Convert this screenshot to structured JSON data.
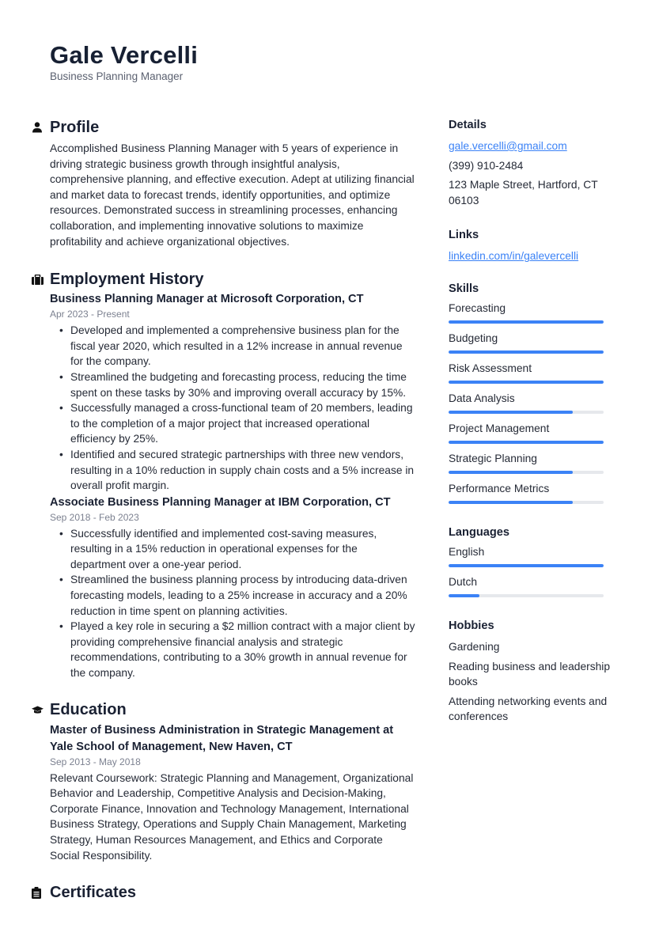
{
  "header": {
    "name": "Gale Vercelli",
    "title": "Business Planning Manager"
  },
  "colors": {
    "accent": "#3b82f6",
    "bar_track": "#e6e8ec",
    "heading": "#1a2133",
    "muted": "#7c8190"
  },
  "profile": {
    "heading": "Profile",
    "icon": "person-icon",
    "text": "Accomplished Business Planning Manager with 5 years of experience in driving strategic business growth through insightful analysis, comprehensive planning, and effective execution. Adept at utilizing financial and market data to forecast trends, identify opportunities, and optimize resources. Demonstrated success in streamlining processes, enhancing collaboration, and implementing innovative solutions to maximize profitability and achieve organizational objectives."
  },
  "employment": {
    "heading": "Employment History",
    "icon": "briefcase-icon",
    "jobs": [
      {
        "title": "Business Planning Manager at Microsoft Corporation, CT",
        "dates": "Apr 2023 - Present",
        "bullets": [
          "Developed and implemented a comprehensive business plan for the fiscal year 2020, which resulted in a 12% increase in annual revenue for the company.",
          "Streamlined the budgeting and forecasting process, reducing the time spent on these tasks by 30% and improving overall accuracy by 15%.",
          "Successfully managed a cross-functional team of 20 members, leading to the completion of a major project that increased operational efficiency by 25%.",
          "Identified and secured strategic partnerships with three new vendors, resulting in a 10% reduction in supply chain costs and a 5% increase in overall profit margin."
        ]
      },
      {
        "title": "Associate Business Planning Manager at IBM Corporation, CT",
        "dates": "Sep 2018 - Feb 2023",
        "bullets": [
          "Successfully identified and implemented cost-saving measures, resulting in a 15% reduction in operational expenses for the department over a one-year period.",
          "Streamlined the business planning process by introducing data-driven forecasting models, leading to a 25% increase in accuracy and a 20% reduction in time spent on planning activities.",
          "Played a key role in securing a $2 million contract with a major client by providing comprehensive financial analysis and strategic recommendations, contributing to a 30% growth in annual revenue for the company."
        ]
      }
    ]
  },
  "education": {
    "heading": "Education",
    "icon": "graduation-cap-icon",
    "entries": [
      {
        "title": "Master of Business Administration in Strategic Management at Yale School of Management, New Haven, CT",
        "dates": "Sep 2013 - May 2018",
        "text": "Relevant Coursework: Strategic Planning and Management, Organizational Behavior and Leadership, Competitive Analysis and Decision-Making, Corporate Finance, Innovation and Technology Management, International Business Strategy, Operations and Supply Chain Management, Marketing Strategy, Human Resources Management, and Ethics and Corporate Social Responsibility."
      }
    ]
  },
  "certificates": {
    "heading": "Certificates",
    "icon": "clipboard-icon"
  },
  "details": {
    "heading": "Details",
    "email": "gale.vercelli@gmail.com",
    "phone": "(399) 910-2484",
    "address": "123 Maple Street, Hartford, CT 06103"
  },
  "links": {
    "heading": "Links",
    "items": [
      "linkedin.com/in/galevercelli"
    ]
  },
  "skills": {
    "heading": "Skills",
    "items": [
      {
        "label": "Forecasting",
        "level_pct": 100
      },
      {
        "label": "Budgeting",
        "level_pct": 100
      },
      {
        "label": "Risk Assessment",
        "level_pct": 100
      },
      {
        "label": "Data Analysis",
        "level_pct": 80
      },
      {
        "label": "Project Management",
        "level_pct": 100
      },
      {
        "label": "Strategic Planning",
        "level_pct": 80
      },
      {
        "label": "Performance Metrics",
        "level_pct": 80
      }
    ]
  },
  "languages": {
    "heading": "Languages",
    "items": [
      {
        "label": "English",
        "level_pct": 100
      },
      {
        "label": "Dutch",
        "level_pct": 20
      }
    ]
  },
  "hobbies": {
    "heading": "Hobbies",
    "items": [
      "Gardening",
      "Reading business and leadership books",
      "Attending networking events and conferences"
    ]
  }
}
